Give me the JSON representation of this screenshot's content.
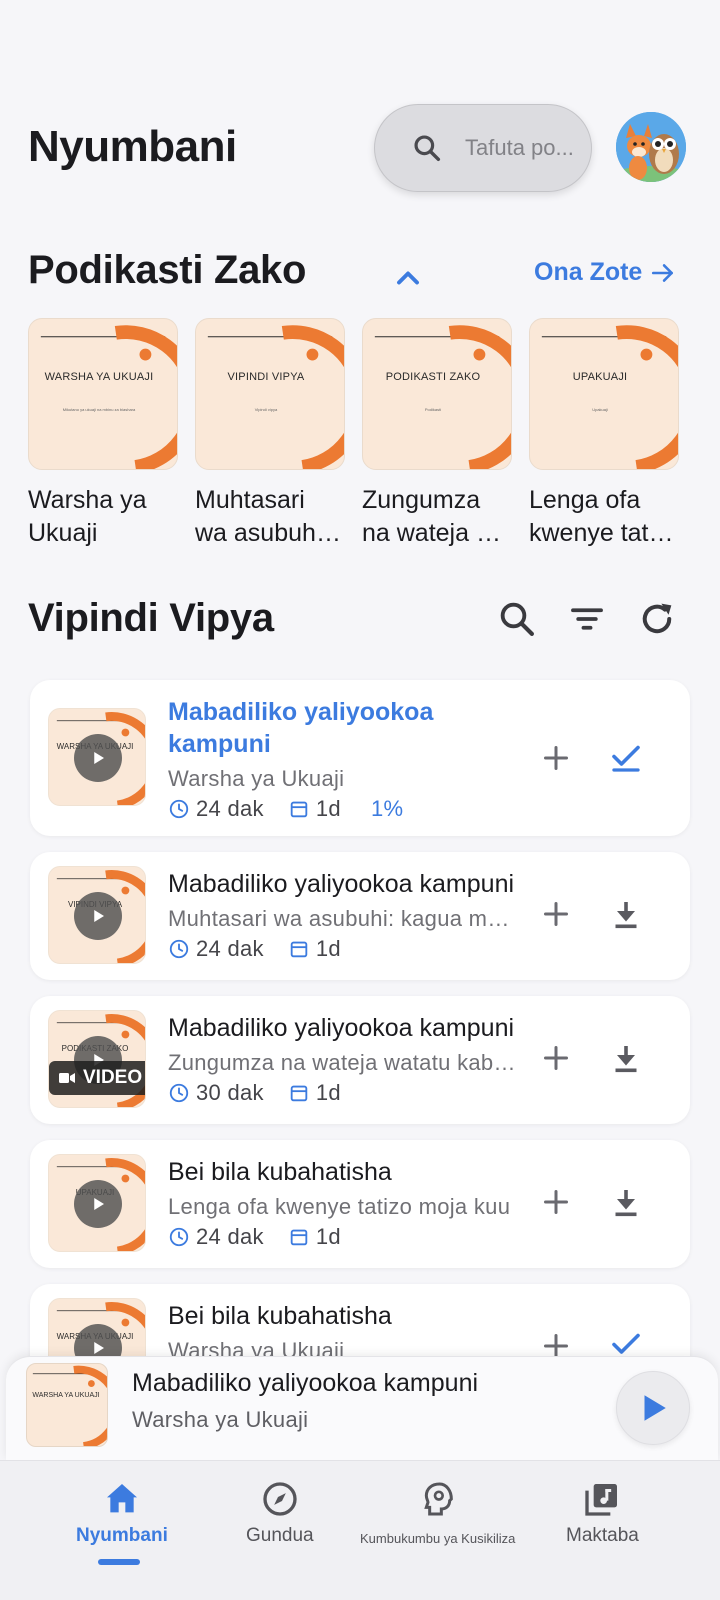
{
  "header": {
    "title": "Nyumbani",
    "search_placeholder": "Tafuta po..."
  },
  "podcasts_section": {
    "title": "Podikasti Zako",
    "see_all": "Ona Zote",
    "items": [
      {
        "cover_title": "WARSHA YA UKUAJI",
        "cover_sub": "Mikutano ya ukuaji na mbinu za biashara",
        "name_line1": "Warsha ya",
        "name_line2": "Ukuaji"
      },
      {
        "cover_title": "VIPINDI VIPYA",
        "cover_sub": "Vipindi vipya",
        "name_line1": "Muhtasari",
        "name_line2": "wa asubuhi: kagua"
      },
      {
        "cover_title": "PODIKASTI ZAKO",
        "cover_sub": "Podikasti",
        "name_line1": "Zungumza",
        "name_line2": "na wateja watatu"
      },
      {
        "cover_title": "UPAKUAJI",
        "cover_sub": "Upakuaji",
        "name_line1": "Lenga ofa",
        "name_line2": "kwenye tatizo"
      }
    ]
  },
  "episodes_section": {
    "title": "Vipindi Vipya",
    "episodes": [
      {
        "thumb_title": "WARSHA YA UKUAJI",
        "title": "Mabadiliko yaliyookoa kampuni",
        "subtitle": "Warsha ya Ukuaji",
        "duration": "24 dak",
        "date": "1d",
        "progress": "1%",
        "status": "played",
        "video": false
      },
      {
        "thumb_title": "VIPINDI VIPYA",
        "title": "Mabadiliko yaliyookoa kampuni",
        "subtitle": "Muhtasari wa asubuhi: kagua matokeo",
        "duration": "24 dak",
        "date": "1d",
        "status": "download",
        "video": false
      },
      {
        "thumb_title": "PODIKASTI ZAKO",
        "title": "Mabadiliko yaliyookoa kampuni",
        "subtitle": "Zungumza na wateja watatu kabla ya",
        "duration": "30 dak",
        "date": "1d",
        "status": "download",
        "video": true,
        "video_label": "VIDEO"
      },
      {
        "thumb_title": "UPAKUAJI",
        "title": "Bei bila kubahatisha",
        "subtitle": "Lenga ofa kwenye tatizo moja kuu",
        "duration": "24 dak",
        "date": "1d",
        "status": "download",
        "video": false
      },
      {
        "thumb_title": "WARSHA YA UKUAJI",
        "title": "Bei bila kubahatisha",
        "subtitle": "Warsha ya Ukuaji",
        "status": "played",
        "video": false
      }
    ]
  },
  "mini_player": {
    "thumb_title": "WARSHA YA UKUAJI",
    "title": "Mabadiliko yaliyookoa kampuni",
    "subtitle": "Warsha ya Ukuaji"
  },
  "bottom_nav": {
    "items": [
      {
        "label": "Nyumbani",
        "icon": "home-icon",
        "active": true
      },
      {
        "label": "Gundua",
        "icon": "compass-icon",
        "active": false
      },
      {
        "label": "Kumbukumbu ya Kusikiliza",
        "icon": "head-gear-icon",
        "active": false
      },
      {
        "label": "Maktaba",
        "icon": "library-music-icon",
        "active": false
      }
    ]
  },
  "colors": {
    "accent": "#3c7bdf",
    "cover_bg": "#fae8d8",
    "cover_orange": "#ec7a32",
    "background": "#f6f6f9"
  }
}
